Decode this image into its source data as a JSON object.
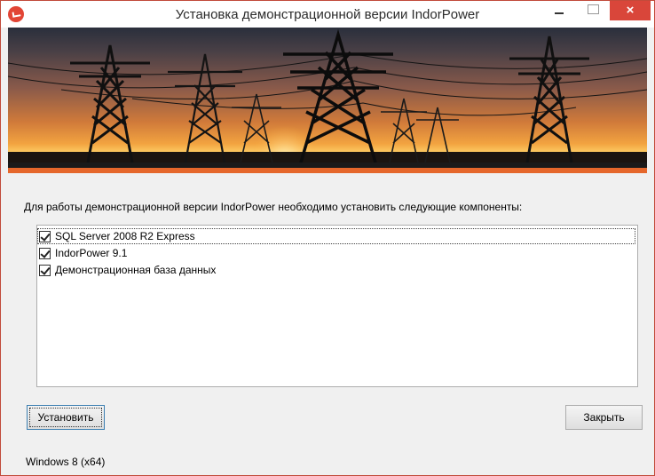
{
  "window": {
    "title": "Установка демонстрационной версии IndorPower",
    "close_glyph": "×"
  },
  "content": {
    "prompt": "Для работы демонстрационной версии IndorPower необходимо установить следующие компоненты:",
    "components": [
      {
        "label": "SQL Server 2008 R2 Express",
        "checked": true
      },
      {
        "label": "IndorPower 9.1",
        "checked": true
      },
      {
        "label": "Демонстрационная база данных",
        "checked": true
      }
    ]
  },
  "buttons": {
    "install_label": "Установить",
    "close_label": "Закрыть"
  },
  "status": {
    "os_info": "Windows 8 (x64)"
  },
  "colors": {
    "close_button": "#d9463a",
    "banner_stripe": "#e5672b",
    "window_border": "#c14a3a"
  }
}
